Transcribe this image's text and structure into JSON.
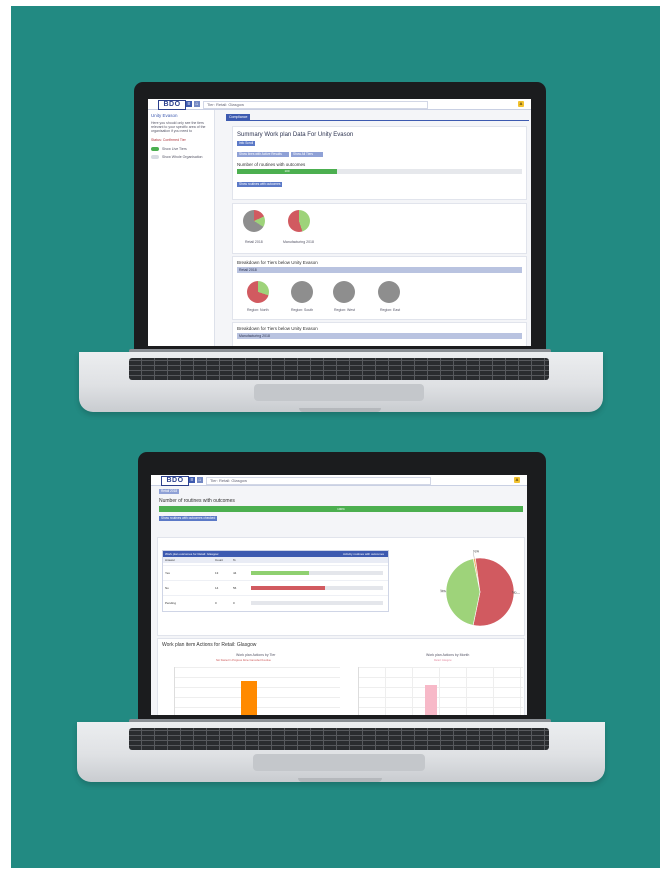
{
  "top": {
    "header": {
      "logo": "BDO",
      "search_text": "Tier: Retail: Glasgow",
      "user": "A"
    },
    "sidebar": {
      "title": "Unity Evason",
      "intro": "Here you should only see the tiers relevant to your specific area of the organisation if you need to",
      "filter_label": "Status: Confirmed Tier",
      "toggle1_label": "Show Live Tiers",
      "toggle2_label": "Show Whole Organisation"
    },
    "tab": "Compliance",
    "summary": {
      "title": "Summary Work plan Data For Unity Evason",
      "small_button": "Info Scroll",
      "dropdown1": "Show lines with Active Results",
      "dropdown2": "Show All Tiers",
      "routines_label": "Number of routines with outcomes",
      "routine_value": "100",
      "action_button": "Show routines with outcomes"
    },
    "pies": [
      {
        "label": "Retail 2018",
        "color_a": "#d15a60",
        "color_b": "#9ed37a"
      },
      {
        "label": "Manufacturing 2018",
        "color_a": "#d15a60",
        "color_b": "#9ed37a"
      }
    ],
    "breakdown1": {
      "title": "Breakdown for Tiers below Unity Evason",
      "header": "Retail 2018",
      "regions": [
        "Region: North",
        "Region: South",
        "Region: West",
        "Region: East"
      ]
    },
    "breakdown2": {
      "title": "Breakdown for Tiers below Unity Evason",
      "header": "Manufacturing 2018"
    }
  },
  "bottom": {
    "header": {
      "logo": "BDO",
      "search_text": "Tier: Retail: Glasgow",
      "user": "A"
    },
    "tier_select": "Retail 2018",
    "routines_label": "Number of routines with outcomes",
    "routine_value": "100%",
    "action_button": "Show routines with outcomes checked",
    "table": {
      "title": "Work plan outcomes for Retail: Glasgow",
      "subtitle": "Activity routines with outcomes",
      "columns": [
        "Answer",
        "Count",
        "%"
      ],
      "rows": [
        {
          "answer": "Yes",
          "count": "13",
          "pct": "44",
          "fill": 0.44,
          "color": "#8fd070"
        },
        {
          "answer": "No",
          "count": "14",
          "pct": "56",
          "fill": 0.56,
          "color": "#d15a60"
        },
        {
          "answer": "Pending",
          "count": "0",
          "pct": "0",
          "fill": 0,
          "color": "#cccccc"
        }
      ]
    },
    "big_pie": {
      "labels": [
        "N/A",
        "No",
        "Yes"
      ],
      "values": [
        1,
        56,
        44
      ],
      "colors": [
        "#f0a860",
        "#d15a60",
        "#9ed37a"
      ]
    },
    "actions": {
      "title": "Work plan item Actions for Retail: Glasgow",
      "chart1_title": "Work plan Actions by Tier",
      "chart1_legend": "Not Started  In Progress  Done  Cancelled  Overdue",
      "chart2_title": "Work plan Actions by Month",
      "chart2_legend": "Retail: Glasgow"
    }
  }
}
